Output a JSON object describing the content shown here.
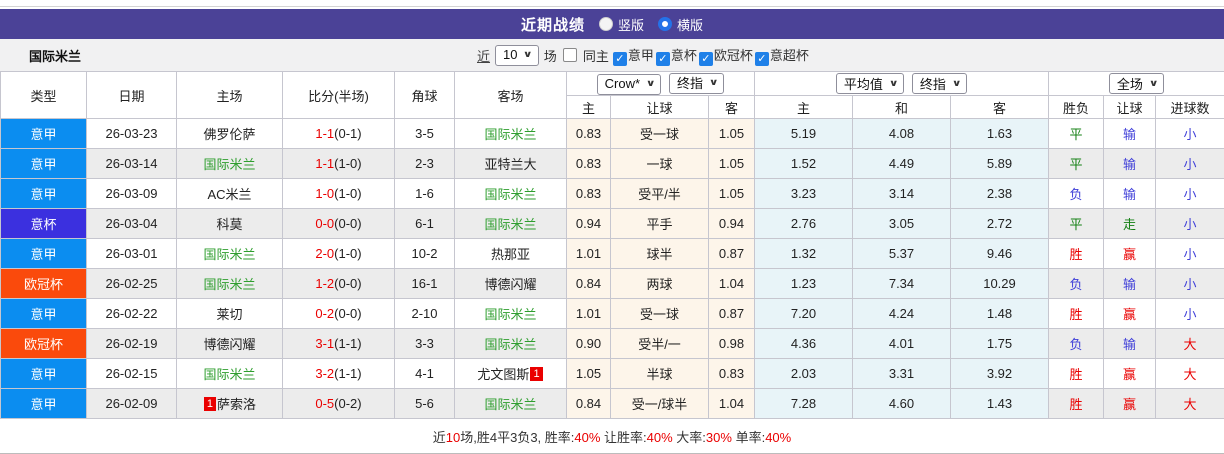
{
  "titlebar": {
    "title": "近期战绩",
    "radio_vertical": "竖版",
    "radio_horizontal": "横版",
    "selected_layout": "横版"
  },
  "filterbar": {
    "team": "国际米兰",
    "recent_label": "近",
    "recent_value": "10",
    "games_label": "场",
    "same_home_label": "同主",
    "same_home_checked": false,
    "competitions": [
      {
        "label": "意甲",
        "checked": true
      },
      {
        "label": "意杯",
        "checked": true
      },
      {
        "label": "欧冠杯",
        "checked": true
      },
      {
        "label": "意超杯",
        "checked": true
      }
    ]
  },
  "table": {
    "dropdowns": {
      "odds_source": "Crow*",
      "odds_time": "终指",
      "europe_avg": "平均值",
      "europe_time": "终指",
      "scope": "全场"
    },
    "columns": [
      "类型",
      "日期",
      "主场",
      "比分(半场)",
      "角球",
      "客场",
      "主",
      "让球",
      "客",
      "主",
      "和",
      "客",
      "胜负",
      "让球",
      "进球数"
    ],
    "rows": [
      {
        "league": "意甲",
        "date": "26-03-23",
        "home": "佛罗伦萨",
        "home_green": false,
        "home_card": "",
        "score_ft": "1-1",
        "score_ht": "(0-1)",
        "corner": "3-5",
        "away": "国际米兰",
        "away_green": true,
        "away_card": "",
        "odds_home": "0.83",
        "handicap": "受一球",
        "odds_away": "1.05",
        "avg_home": "5.19",
        "avg_draw": "4.08",
        "avg_away": "1.63",
        "result": "平",
        "result_c": "green",
        "let": "输",
        "let_c": "blue",
        "goals": "小",
        "goals_c": "blue"
      },
      {
        "league": "意甲",
        "date": "26-03-14",
        "home": "国际米兰",
        "home_green": true,
        "home_card": "",
        "score_ft": "1-1",
        "score_ht": "(1-0)",
        "corner": "2-3",
        "away": "亚特兰大",
        "away_green": false,
        "away_card": "",
        "odds_home": "0.83",
        "handicap": "一球",
        "odds_away": "1.05",
        "avg_home": "1.52",
        "avg_draw": "4.49",
        "avg_away": "5.89",
        "result": "平",
        "result_c": "green",
        "let": "输",
        "let_c": "blue",
        "goals": "小",
        "goals_c": "blue"
      },
      {
        "league": "意甲",
        "date": "26-03-09",
        "home": "AC米兰",
        "home_green": false,
        "home_card": "",
        "score_ft": "1-0",
        "score_ht": "(1-0)",
        "corner": "1-6",
        "away": "国际米兰",
        "away_green": true,
        "away_card": "",
        "odds_home": "0.83",
        "handicap": "受平/半",
        "odds_away": "1.05",
        "avg_home": "3.23",
        "avg_draw": "3.14",
        "avg_away": "2.38",
        "result": "负",
        "result_c": "blue",
        "let": "输",
        "let_c": "blue",
        "goals": "小",
        "goals_c": "blue"
      },
      {
        "league": "意杯",
        "date": "26-03-04",
        "home": "科莫",
        "home_green": false,
        "home_card": "",
        "score_ft": "0-0",
        "score_ht": "(0-0)",
        "corner": "6-1",
        "away": "国际米兰",
        "away_green": true,
        "away_card": "",
        "odds_home": "0.94",
        "handicap": "平手",
        "odds_away": "0.94",
        "avg_home": "2.76",
        "avg_draw": "3.05",
        "avg_away": "2.72",
        "result": "平",
        "result_c": "green",
        "let": "走",
        "let_c": "green",
        "goals": "小",
        "goals_c": "blue"
      },
      {
        "league": "意甲",
        "date": "26-03-01",
        "home": "国际米兰",
        "home_green": true,
        "home_card": "",
        "score_ft": "2-0",
        "score_ht": "(1-0)",
        "corner": "10-2",
        "away": "热那亚",
        "away_green": false,
        "away_card": "",
        "odds_home": "1.01",
        "handicap": "球半",
        "odds_away": "0.87",
        "avg_home": "1.32",
        "avg_draw": "5.37",
        "avg_away": "9.46",
        "result": "胜",
        "result_c": "red",
        "let": "赢",
        "let_c": "red",
        "goals": "小",
        "goals_c": "blue"
      },
      {
        "league": "欧冠杯",
        "date": "26-02-25",
        "home": "国际米兰",
        "home_green": true,
        "home_card": "",
        "score_ft": "1-2",
        "score_ht": "(0-0)",
        "corner": "16-1",
        "away": "博德闪耀",
        "away_green": false,
        "away_card": "",
        "odds_home": "0.84",
        "handicap": "两球",
        "odds_away": "1.04",
        "avg_home": "1.23",
        "avg_draw": "7.34",
        "avg_away": "10.29",
        "result": "负",
        "result_c": "blue",
        "let": "输",
        "let_c": "blue",
        "goals": "小",
        "goals_c": "blue"
      },
      {
        "league": "意甲",
        "date": "26-02-22",
        "home": "莱切",
        "home_green": false,
        "home_card": "",
        "score_ft": "0-2",
        "score_ht": "(0-0)",
        "corner": "2-10",
        "away": "国际米兰",
        "away_green": true,
        "away_card": "",
        "odds_home": "1.01",
        "handicap": "受一球",
        "odds_away": "0.87",
        "avg_home": "7.20",
        "avg_draw": "4.24",
        "avg_away": "1.48",
        "result": "胜",
        "result_c": "red",
        "let": "赢",
        "let_c": "red",
        "goals": "小",
        "goals_c": "blue"
      },
      {
        "league": "欧冠杯",
        "date": "26-02-19",
        "home": "博德闪耀",
        "home_green": false,
        "home_card": "",
        "score_ft": "3-1",
        "score_ht": "(1-1)",
        "corner": "3-3",
        "away": "国际米兰",
        "away_green": true,
        "away_card": "",
        "odds_home": "0.90",
        "handicap": "受半/一",
        "odds_away": "0.98",
        "avg_home": "4.36",
        "avg_draw": "4.01",
        "avg_away": "1.75",
        "result": "负",
        "result_c": "blue",
        "let": "输",
        "let_c": "blue",
        "goals": "大",
        "goals_c": "red"
      },
      {
        "league": "意甲",
        "date": "26-02-15",
        "home": "国际米兰",
        "home_green": true,
        "home_card": "",
        "score_ft": "3-2",
        "score_ht": "(1-1)",
        "corner": "4-1",
        "away": "尤文图斯",
        "away_green": false,
        "away_card": "1",
        "odds_home": "1.05",
        "handicap": "半球",
        "odds_away": "0.83",
        "avg_home": "2.03",
        "avg_draw": "3.31",
        "avg_away": "3.92",
        "result": "胜",
        "result_c": "red",
        "let": "赢",
        "let_c": "red",
        "goals": "大",
        "goals_c": "red"
      },
      {
        "league": "意甲",
        "date": "26-02-09",
        "home": "萨索洛",
        "home_green": false,
        "home_card": "1",
        "score_ft": "0-5",
        "score_ht": "(0-2)",
        "corner": "5-6",
        "away": "国际米兰",
        "away_green": true,
        "away_card": "",
        "odds_home": "0.84",
        "handicap": "受一/球半",
        "odds_away": "1.04",
        "avg_home": "7.28",
        "avg_draw": "4.60",
        "avg_away": "1.43",
        "result": "胜",
        "result_c": "red",
        "let": "赢",
        "let_c": "red",
        "goals": "大",
        "goals_c": "red"
      }
    ]
  },
  "footer": {
    "segments": [
      {
        "text": "近",
        "color": "black"
      },
      {
        "text": "10",
        "color": "red"
      },
      {
        "text": "场,胜4平3负3, 胜率:",
        "color": "black"
      },
      {
        "text": "40%",
        "color": "red"
      },
      {
        "text": " 让胜率:",
        "color": "black"
      },
      {
        "text": "40%",
        "color": "red"
      },
      {
        "text": " 大率:",
        "color": "black"
      },
      {
        "text": "30%",
        "color": "red"
      },
      {
        "text": " 单率:",
        "color": "black"
      },
      {
        "text": "40%",
        "color": "red"
      }
    ]
  },
  "colors": {
    "header_purple": "#4b4297",
    "league": {
      "意甲": "#0b8df0",
      "意杯": "#3b30df",
      "欧冠杯": "#fa4a0c"
    },
    "result": {
      "red": "#ea0000",
      "green": "#148014",
      "blue": "#3f3fd8"
    },
    "team_green": "#2e9e2e",
    "score_red": "#ea0000",
    "checkbox_blue": "#1f80e8",
    "odds_bg": "#fdf5ea",
    "avg_bg": "#e8f4f8"
  }
}
